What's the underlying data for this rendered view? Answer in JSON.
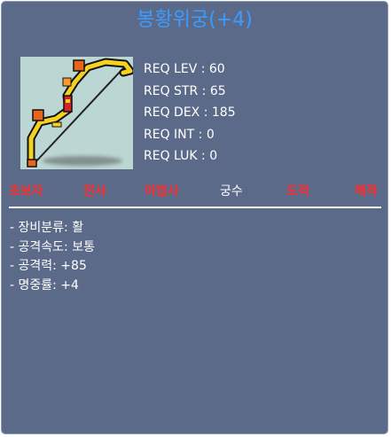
{
  "item": {
    "name": "봉황위궁(+4)",
    "icon": "golden-bow-icon",
    "requirements": [
      "REQ LEV : 60",
      "REQ STR : 65",
      "REQ DEX : 185",
      "REQ INT : 0",
      "REQ LUK : 0"
    ],
    "jobs": [
      {
        "label": "초보자",
        "eligible": false
      },
      {
        "label": "전사",
        "eligible": false
      },
      {
        "label": "마법사",
        "eligible": false
      },
      {
        "label": "궁수",
        "eligible": true
      },
      {
        "label": "도적",
        "eligible": false
      },
      {
        "label": "해적",
        "eligible": false
      }
    ],
    "properties": [
      "- 장비분류: 활",
      "- 공격속도: 보통",
      "- 공격력: +85",
      "- 명중률: +4"
    ]
  },
  "colors": {
    "panel_bg": "#5c6a89",
    "title": "#3a9cff",
    "job_ineligible": "#ff2a2a",
    "job_eligible": "#ffffff",
    "icon_bg": "#bcd6d3"
  }
}
